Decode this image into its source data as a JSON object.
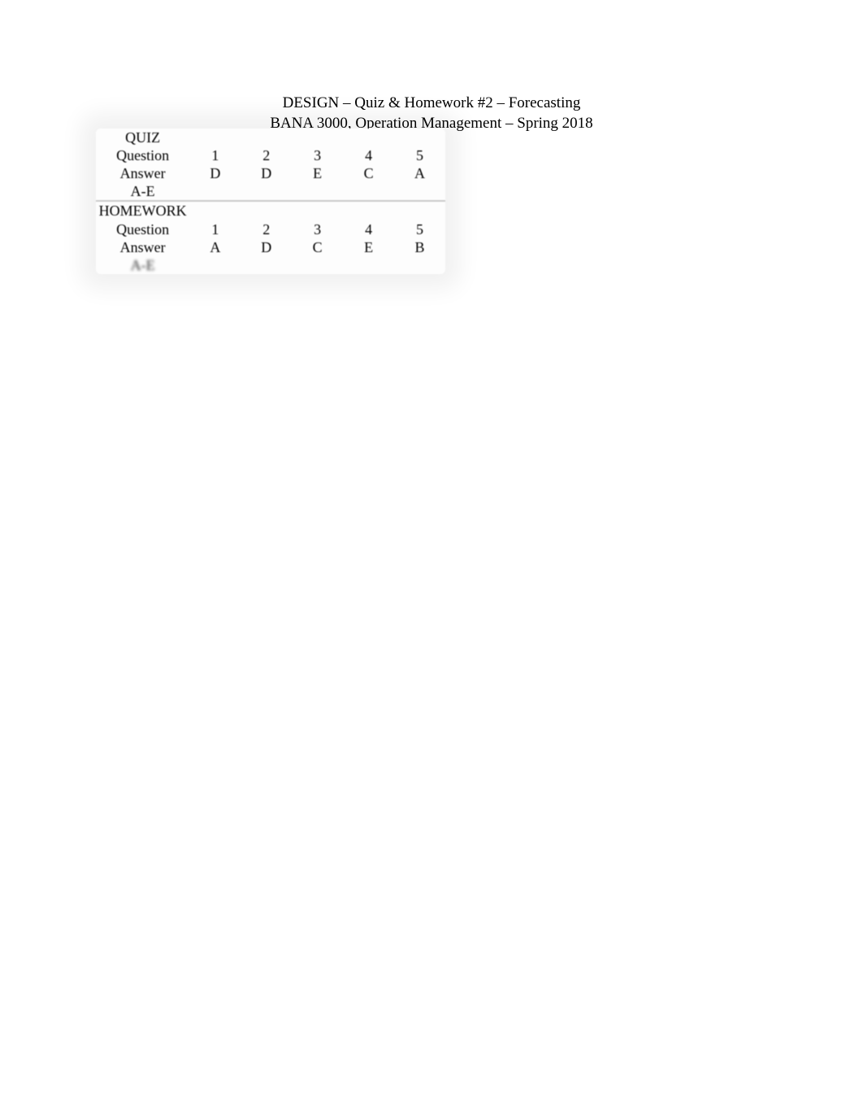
{
  "header": {
    "line1": "DESIGN – Quiz & Homework #2 – Forecasting",
    "line2": "BANA 3000, Operation Management – Spring 2018"
  },
  "sections": [
    {
      "title": "QUIZ",
      "question_label": "Question",
      "answer_label": "Answer",
      "scale_label": "A-E",
      "questions": [
        "1",
        "2",
        "3",
        "4",
        "5"
      ],
      "answers": [
        "D",
        "D",
        "E",
        "C",
        "A"
      ]
    },
    {
      "title": "HOMEWORK",
      "question_label": "Question",
      "answer_label": "Answer",
      "scale_label": "A-E",
      "questions": [
        "1",
        "2",
        "3",
        "4",
        "5"
      ],
      "answers": [
        "A",
        "D",
        "C",
        "E",
        "B"
      ]
    }
  ]
}
